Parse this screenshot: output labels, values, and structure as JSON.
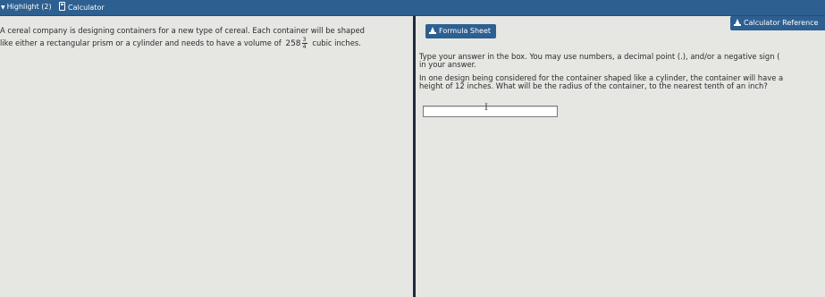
{
  "toolbar": {
    "highlight_label": "Highlight (2)",
    "calculator_label": "Calculator"
  },
  "passage": {
    "line1": "A cereal company is designing containers for a new type of cereal. Each container will be shaped",
    "line2_before": "like either a rectangular prism or a cylinder and needs to have a volume of",
    "volume_whole": "258",
    "volume_frac_num": "3",
    "volume_frac_den": "4",
    "line2_after": "cubic inches."
  },
  "buttons": {
    "formula_sheet": "Formula Sheet",
    "calculator_reference": "Calculator Reference"
  },
  "instructions": {
    "line1": "Type your answer in the box. You may use numbers, a decimal point (.), and/or a negative sign (",
    "line2": "in your answer."
  },
  "question": {
    "line1": "In one design being considered for the container shaped like a cylinder, the container will have a",
    "line2": "height of 12 inches. What will be the radius of the container, to the nearest tenth of an inch?"
  },
  "answer": {
    "value": ""
  },
  "colors": {
    "toolbar": "#2d5f91",
    "background": "#e6e6e3",
    "divider": "#1f2d3a"
  }
}
